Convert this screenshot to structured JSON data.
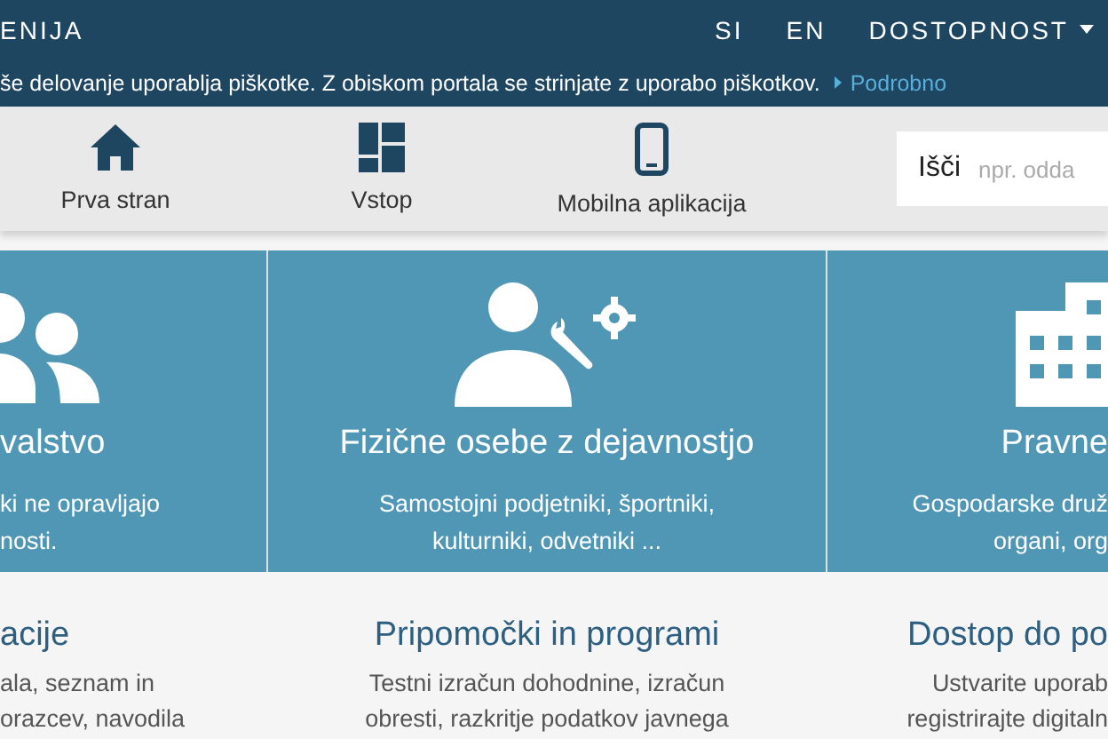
{
  "top_bar": {
    "title": "ENIJA",
    "languages": [
      {
        "label": "SI"
      },
      {
        "label": "EN"
      }
    ],
    "accessibility": {
      "label": "DOSTOPNOST"
    }
  },
  "cookie_notice": {
    "text": "še delovanje uporablja piškotke. Z obiskom portala se strinjate z uporabo piškotkov.",
    "link": "Podrobno"
  },
  "nav": {
    "items": [
      {
        "kind": "home",
        "label": "Prva stran"
      },
      {
        "kind": "login",
        "label": "Vstop"
      },
      {
        "kind": "mobile",
        "label": "Mobilna aplikacija"
      }
    ],
    "search": {
      "label": "Išči",
      "placeholder": "npr. odda"
    }
  },
  "tiles": [
    {
      "kind": "people",
      "title": "valstvo",
      "description_lines": [
        "ki ne opravljajo",
        "nosti."
      ]
    },
    {
      "kind": "self_employed",
      "title": "Fizične osebe z dejavnostjo",
      "description_lines": [
        "Samostojni podjetniki, športniki,",
        "kulturniki, odvetniki ..."
      ]
    },
    {
      "kind": "company",
      "title": "Pravne",
      "description_lines": [
        "Gospodarske druž",
        "organi, org"
      ]
    }
  ],
  "sections": [
    {
      "title": "acije",
      "description_lines": [
        "ala, seznam in",
        "orazcev, navodila"
      ]
    },
    {
      "title": "Pripomočki in programi",
      "description_lines": [
        "Testni izračun dohodnine, izračun",
        "obresti, razkritje podatkov javnega"
      ]
    },
    {
      "title": "Dostop do po",
      "description_lines": [
        "Ustvarite uporab",
        "registrirajte digitaln"
      ]
    }
  ]
}
